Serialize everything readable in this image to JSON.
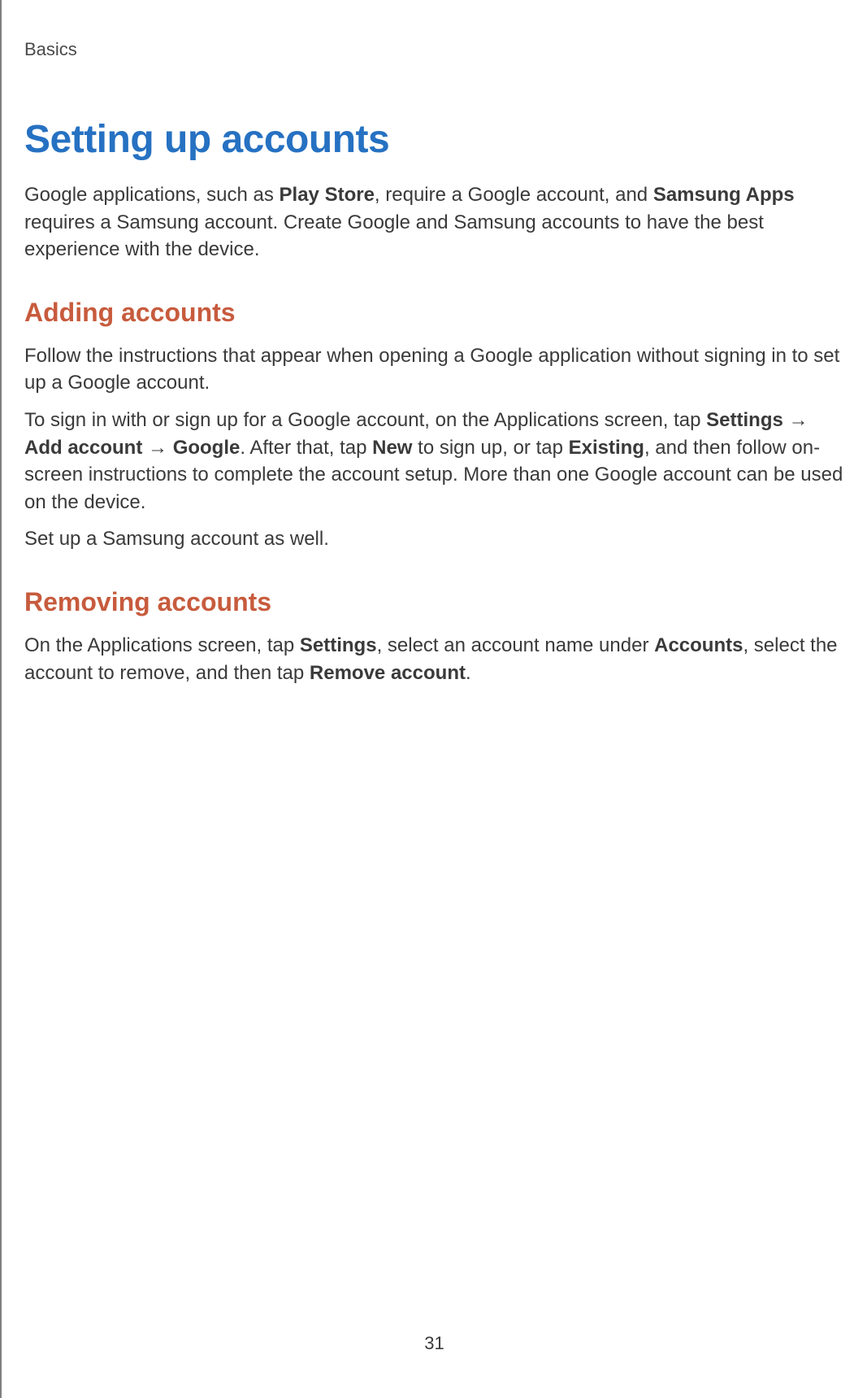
{
  "breadcrumb": "Basics",
  "h1": "Setting up accounts",
  "intro": {
    "t1": "Google applications, such as ",
    "b1": "Play Store",
    "t2": ", require a Google account, and ",
    "b2": "Samsung Apps",
    "t3": " requires a Samsung account. Create Google and Samsung accounts to have the best experience with the device."
  },
  "section1": {
    "heading": "Adding accounts",
    "p1": "Follow the instructions that appear when opening a Google application without signing in to set up a Google account.",
    "p2": {
      "t1": "To sign in with or sign up for a Google account, on the Applications screen, tap ",
      "b1": "Settings",
      "arrow1": " → ",
      "b2": "Add account",
      "arrow2": " → ",
      "b3": "Google",
      "t2": ". After that, tap ",
      "b4": "New",
      "t3": " to sign up, or tap ",
      "b5": "Existing",
      "t4": ", and then follow on-screen instructions to complete the account setup. More than one Google account can be used on the device."
    },
    "p3": "Set up a Samsung account as well."
  },
  "section2": {
    "heading": "Removing accounts",
    "p1": {
      "t1": "On the Applications screen, tap ",
      "b1": "Settings",
      "t2": ", select an account name under ",
      "b2": "Accounts",
      "t3": ", select the account to remove, and then tap ",
      "b3": "Remove account",
      "t4": "."
    }
  },
  "pageNumber": "31"
}
